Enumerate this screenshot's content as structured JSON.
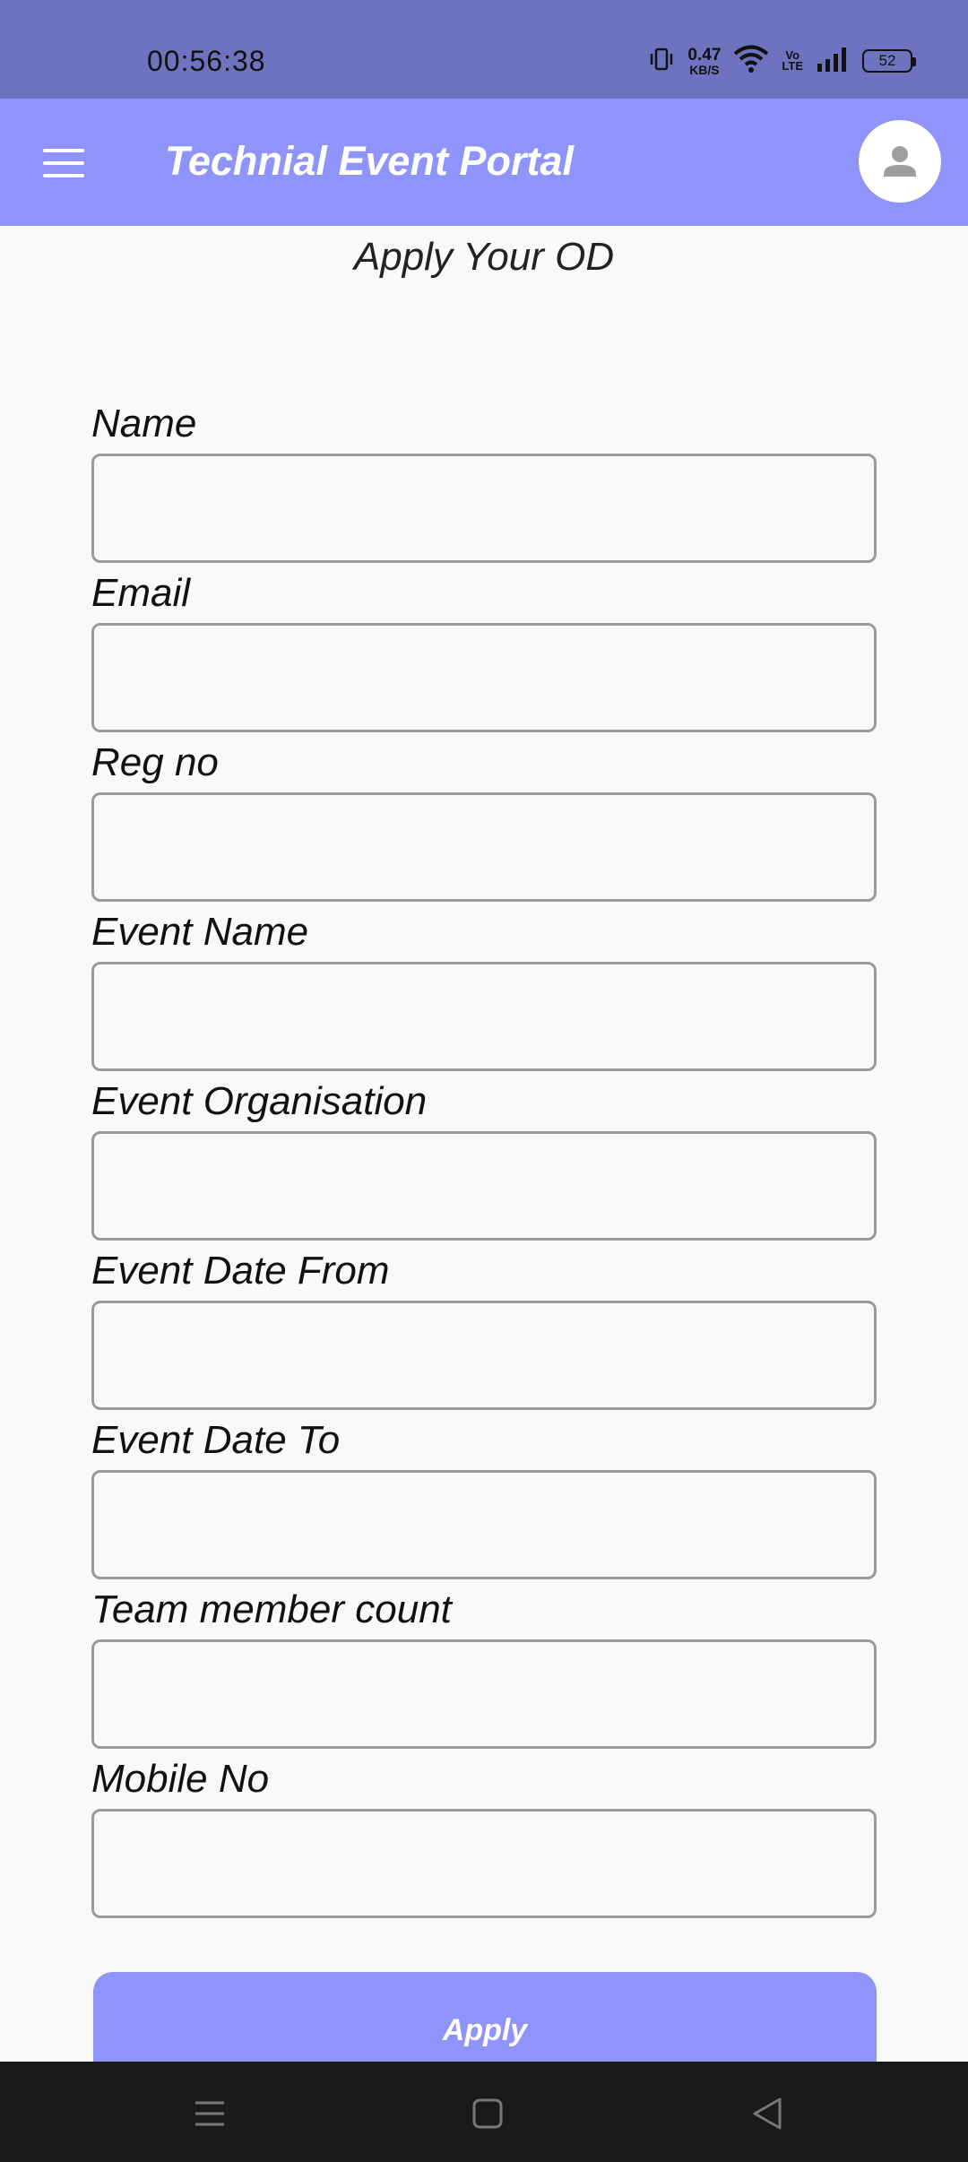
{
  "status_bar": {
    "time": "00:56:38",
    "net_speed_value": "0.47",
    "net_speed_unit": "KB/S",
    "volte_top": "Vo",
    "volte_bottom": "LTE",
    "battery": "52",
    "icons": [
      "vibrate-icon",
      "wifi-icon",
      "volte-icon",
      "signal-icon",
      "battery-icon"
    ]
  },
  "app_bar": {
    "title": "Technial Event Portal",
    "menu_icon": "hamburger-menu-icon",
    "avatar_icon": "person-icon"
  },
  "page": {
    "heading": "Apply Your OD"
  },
  "form": {
    "fields": [
      {
        "label": "Name",
        "value": "",
        "placeholder": ""
      },
      {
        "label": "Email",
        "value": "",
        "placeholder": ""
      },
      {
        "label": "Reg no",
        "value": "",
        "placeholder": ""
      },
      {
        "label": "Event Name",
        "value": "",
        "placeholder": ""
      },
      {
        "label": "Event Organisation",
        "value": "",
        "placeholder": ""
      },
      {
        "label": "Event Date From",
        "value": "",
        "placeholder": ""
      },
      {
        "label": "Event Date To",
        "value": "",
        "placeholder": ""
      },
      {
        "label": "Team member count",
        "value": "",
        "placeholder": ""
      },
      {
        "label": "Mobile No",
        "value": "",
        "placeholder": ""
      }
    ],
    "submit_label": "Apply"
  },
  "nav_bar": {
    "icons": [
      "recent-apps-icon",
      "home-icon",
      "back-icon"
    ]
  },
  "colors": {
    "status_bar": "#6d73bf",
    "app_bar": "#8e94f9",
    "button": "#8e94f9",
    "background": "#f9f9f9",
    "nav_bar": "#1a1a1a"
  }
}
